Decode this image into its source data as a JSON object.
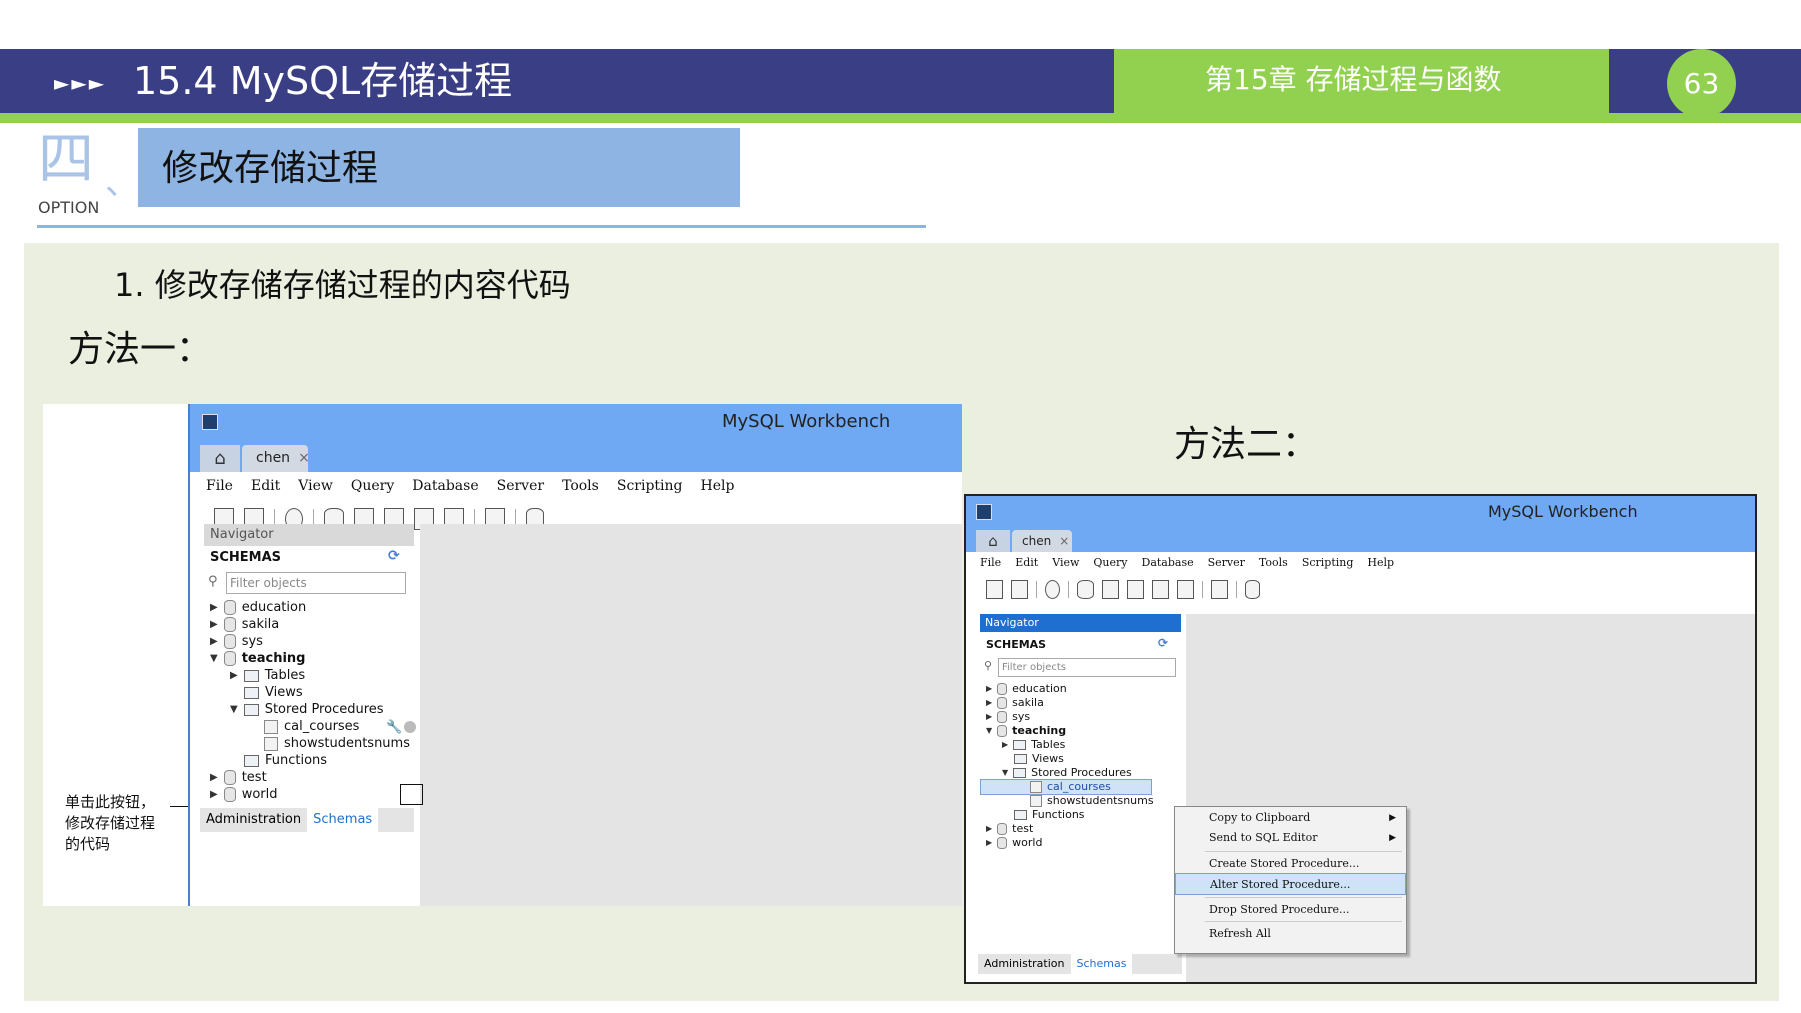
{
  "header": {
    "arrows": "►►►",
    "title": "15.4 MySQL存储过程",
    "chapter": "第15章 存储过程与函数",
    "page_number": "63"
  },
  "section": {
    "number": "四",
    "separator": "、",
    "option_label": "OPTION",
    "title": "修改存储过程"
  },
  "content": {
    "item1": "1. 修改存储存储过程的内容代码",
    "method1": "方法一：",
    "method2": "方法二：",
    "annotation": [
      "单击此按钮，",
      "修改存储过程",
      "的代码"
    ]
  },
  "workbench1": {
    "window_title": "MySQL Workbench",
    "tab_label": "chen",
    "tab_close": "×",
    "menu": [
      "File",
      "Edit",
      "View",
      "Query",
      "Database",
      "Server",
      "Tools",
      "Scripting",
      "Help"
    ],
    "navigator_label": "Navigator",
    "schemas_label": "SCHEMAS",
    "filter_placeholder": "Filter objects",
    "tree": {
      "education": "education",
      "sakila": "sakila",
      "sys": "sys",
      "teaching": "teaching",
      "tables": "Tables",
      "views": "Views",
      "stored_procedures": "Stored Procedures",
      "cal_courses": "cal_courses",
      "showstudentsnums": "showstudentsnums",
      "functions": "Functions",
      "test": "test",
      "world": "world"
    },
    "bottom_tabs": [
      "Administration",
      "Schemas"
    ]
  },
  "workbench2": {
    "window_title": "MySQL Workbench",
    "tab_label": "chen",
    "tab_close": "×",
    "menu": [
      "File",
      "Edit",
      "View",
      "Query",
      "Database",
      "Server",
      "Tools",
      "Scripting",
      "Help"
    ],
    "navigator_label": "Navigator",
    "schemas_label": "SCHEMAS",
    "filter_placeholder": "Filter objects",
    "tree": {
      "education": "education",
      "sakila": "sakila",
      "sys": "sys",
      "teaching": "teaching",
      "tables": "Tables",
      "views": "Views",
      "stored_procedures": "Stored Procedures",
      "cal_courses": "cal_courses",
      "showstudentsnums": "showstudentsnums",
      "functions": "Functions",
      "test": "test",
      "world": "world"
    },
    "bottom_tabs": [
      "Administration",
      "Schemas"
    ],
    "context_menu": [
      "Copy to Clipboard",
      "Send to SQL Editor",
      "Create Stored Procedure...",
      "Alter Stored Procedure...",
      "Drop Stored Procedure...",
      "Refresh All"
    ]
  }
}
